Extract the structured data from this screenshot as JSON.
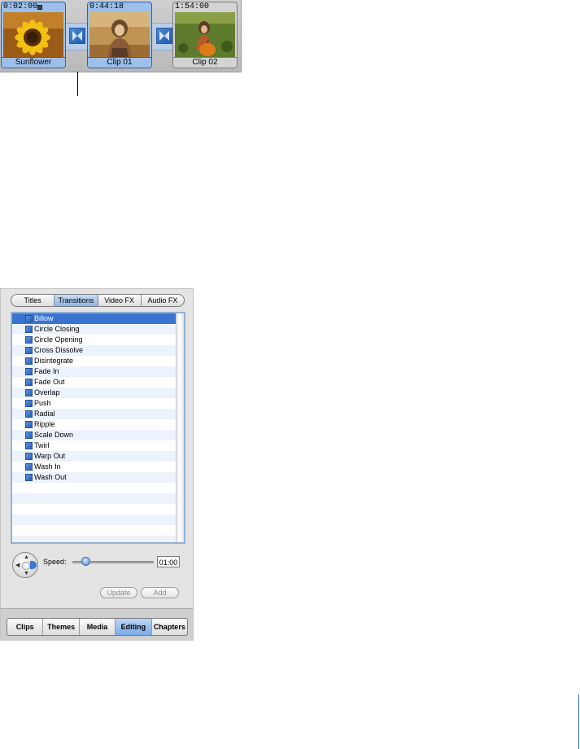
{
  "clip_viewer": {
    "clips": [
      {
        "timecode": "0:02:00",
        "name": "Sunflower"
      },
      {
        "timecode": "0:44:18",
        "name": "Clip 01"
      },
      {
        "timecode": "1:54:00",
        "name": "Clip 02"
      }
    ]
  },
  "editing_pane": {
    "tabs": [
      "Titles",
      "Transitions",
      "Video FX",
      "Audio FX"
    ],
    "selected_tab": "Transitions",
    "transitions": [
      "Billow",
      "Circle Closing",
      "Circle Opening",
      "Cross Dissolve",
      "Disintegrate",
      "Fade In",
      "Fade Out",
      "Overlap",
      "Push",
      "Radial",
      "Ripple",
      "Scale Down",
      "Twirl",
      "Warp Out",
      "Wash In",
      "Wash Out"
    ],
    "selected_transition": "Billow",
    "speed_label": "Speed:",
    "speed_value": "01:00",
    "speed_slider_fraction": 0.12,
    "update_label": "Update",
    "add_label": "Add"
  },
  "mode_bar": {
    "buttons": [
      "Clips",
      "Themes",
      "Media",
      "Editing",
      "Chapters"
    ],
    "selected": "Editing"
  },
  "colors": {
    "selection_blue": "#3a74d0",
    "clip_frame_blue": "#9dc0ea",
    "active_mode": "#7aaae7"
  }
}
